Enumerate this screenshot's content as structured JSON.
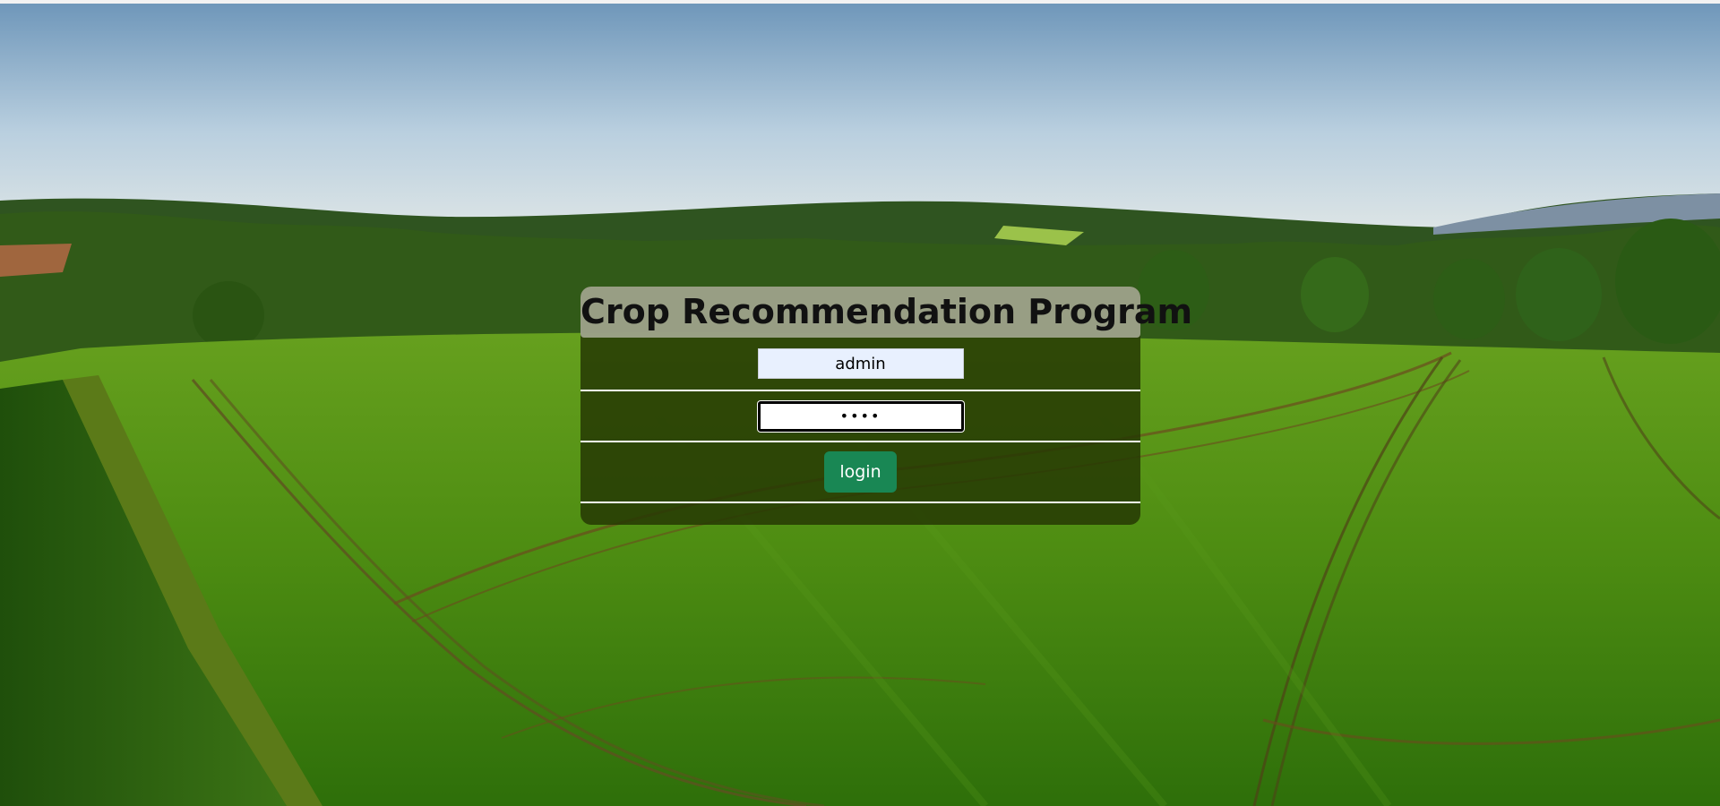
{
  "page": {
    "title": "Crop Recommendation Program"
  },
  "login_form": {
    "username_value": "admin",
    "password_value": "1234",
    "login_label": "login"
  },
  "theme": {
    "panel_color": "#263804",
    "header_color": "#a8ac96",
    "button_color": "#198754",
    "background": "green crop field under blue sky"
  }
}
